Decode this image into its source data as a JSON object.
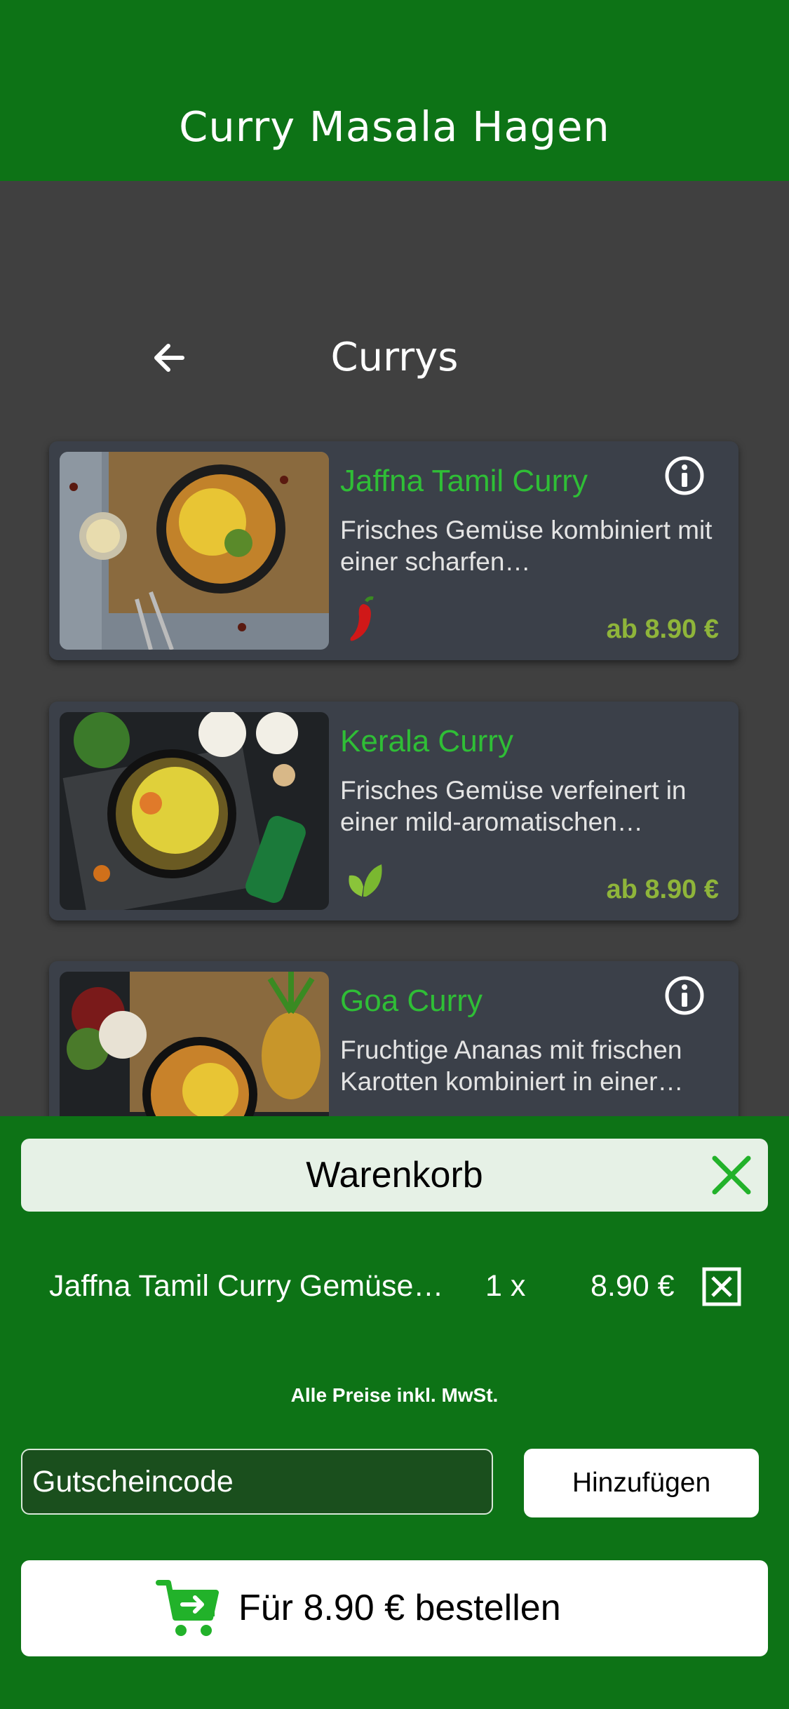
{
  "header": {
    "title": "Curry Masala Hagen"
  },
  "nav": {
    "title": "Currys"
  },
  "menu": [
    {
      "name": "Jaffna Tamil Curry",
      "description": "Frisches Gemüse kombiniert mit einer scharfen…",
      "price": "ab 8.90 €",
      "badge_icon": "chili-icon",
      "has_info": true
    },
    {
      "name": "Kerala Curry",
      "description": "Frisches Gemüse verfeinert in einer mild-aromatischen…",
      "price": "ab 8.90 €",
      "badge_icon": "leaf-icon",
      "has_info": false
    },
    {
      "name": "Goa Curry",
      "description": "Fruchtige Ananas mit frischen Karotten kombiniert in einer…",
      "price": "",
      "badge_icon": "",
      "has_info": true
    }
  ],
  "cart": {
    "title": "Warenkorb",
    "items": [
      {
        "name": "Jaffna Tamil Curry Gemüse…",
        "qty": "1 x",
        "price": "8.90 €"
      }
    ],
    "vat_note": "Alle Preise inkl. MwSt.",
    "voucher_placeholder": "Gutscheincode",
    "add_label": "Hinzufügen",
    "order_label": "Für 8.90 € bestellen"
  },
  "colors": {
    "brand_green": "#0d7316",
    "name_green": "#2fbe36",
    "price_green": "#8fb53a",
    "card_bg": "#3b4049",
    "page_bg": "#404040"
  }
}
